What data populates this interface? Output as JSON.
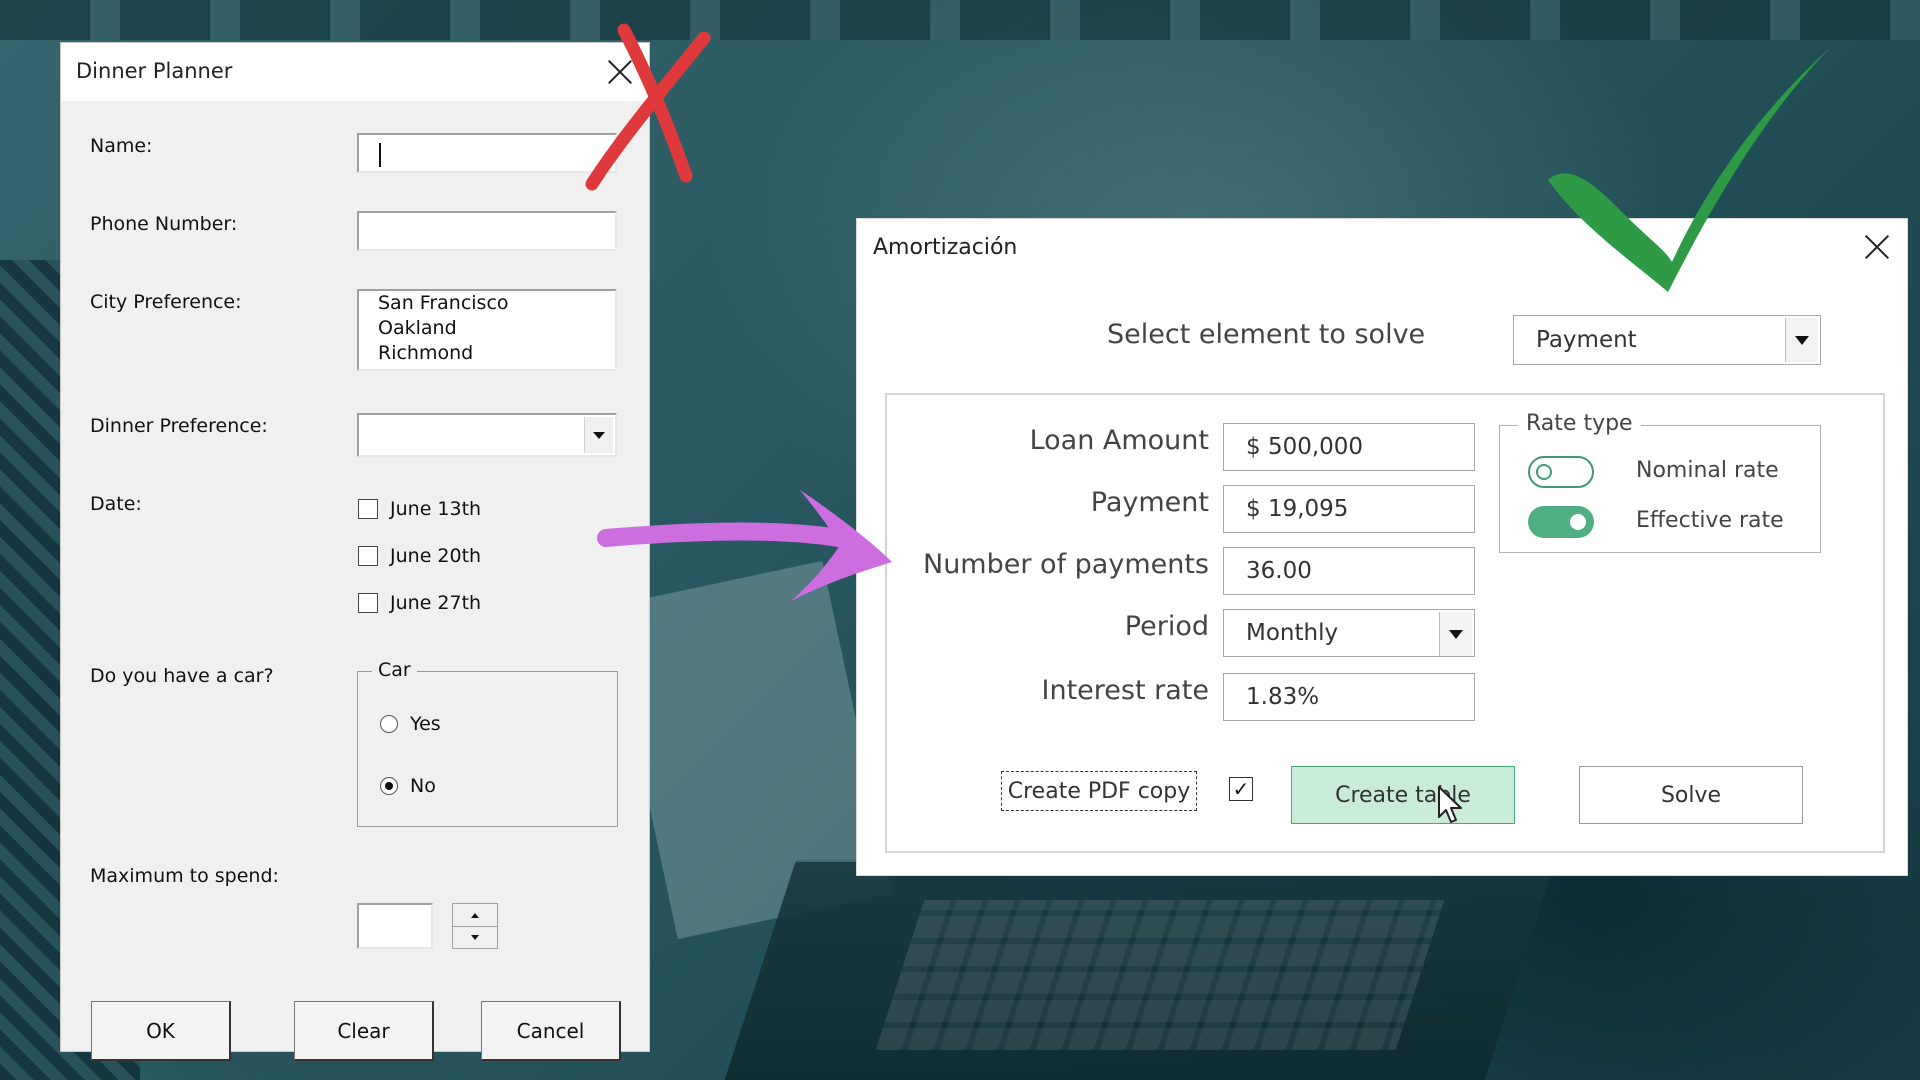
{
  "dinner_planner": {
    "title": "Dinner Planner",
    "name_label": "Name:",
    "phone_label": "Phone Number:",
    "city_label": "City Preference:",
    "city_options": [
      "San Francisco",
      "Oakland",
      "Richmond"
    ],
    "dinner_label": "Dinner Preference:",
    "date_label": "Date:",
    "dates": [
      "June 13th",
      "June 20th",
      "June 27th"
    ],
    "car_label": "Do you have a car?",
    "car_frame": "Car",
    "car_yes": "Yes",
    "car_no": "No",
    "car_selected": "No",
    "max_label": "Maximum to spend:",
    "buttons": {
      "ok": "OK",
      "clear": "Clear",
      "cancel": "Cancel"
    }
  },
  "amortizacion": {
    "title": "Amortización",
    "solve_label": "Select element to solve",
    "solve_value": "Payment",
    "fields": {
      "loan_label": "Loan Amount",
      "loan_value": "$ 500,000",
      "payment_label": "Payment",
      "payment_value": "$ 19,095",
      "num_label": "Number of payments",
      "num_value": "36.00",
      "period_label": "Period",
      "period_value": "Monthly",
      "rate_label": "Interest rate",
      "rate_value": "1.83%"
    },
    "rate_type": {
      "caption": "Rate type",
      "nominal": "Nominal rate",
      "effective": "Effective rate",
      "selected": "Effective rate"
    },
    "pdf_label": "Create PDF copy",
    "pdf_checked": true,
    "create_table": "Create table",
    "solve_button": "Solve"
  },
  "annotations": {
    "bad_mark": "red-x",
    "good_mark": "green-checkmark",
    "arrow": "purple-arrow",
    "colors": {
      "red": "#e0393b",
      "green": "#2e9a46",
      "purple": "#cc6ee0"
    }
  }
}
